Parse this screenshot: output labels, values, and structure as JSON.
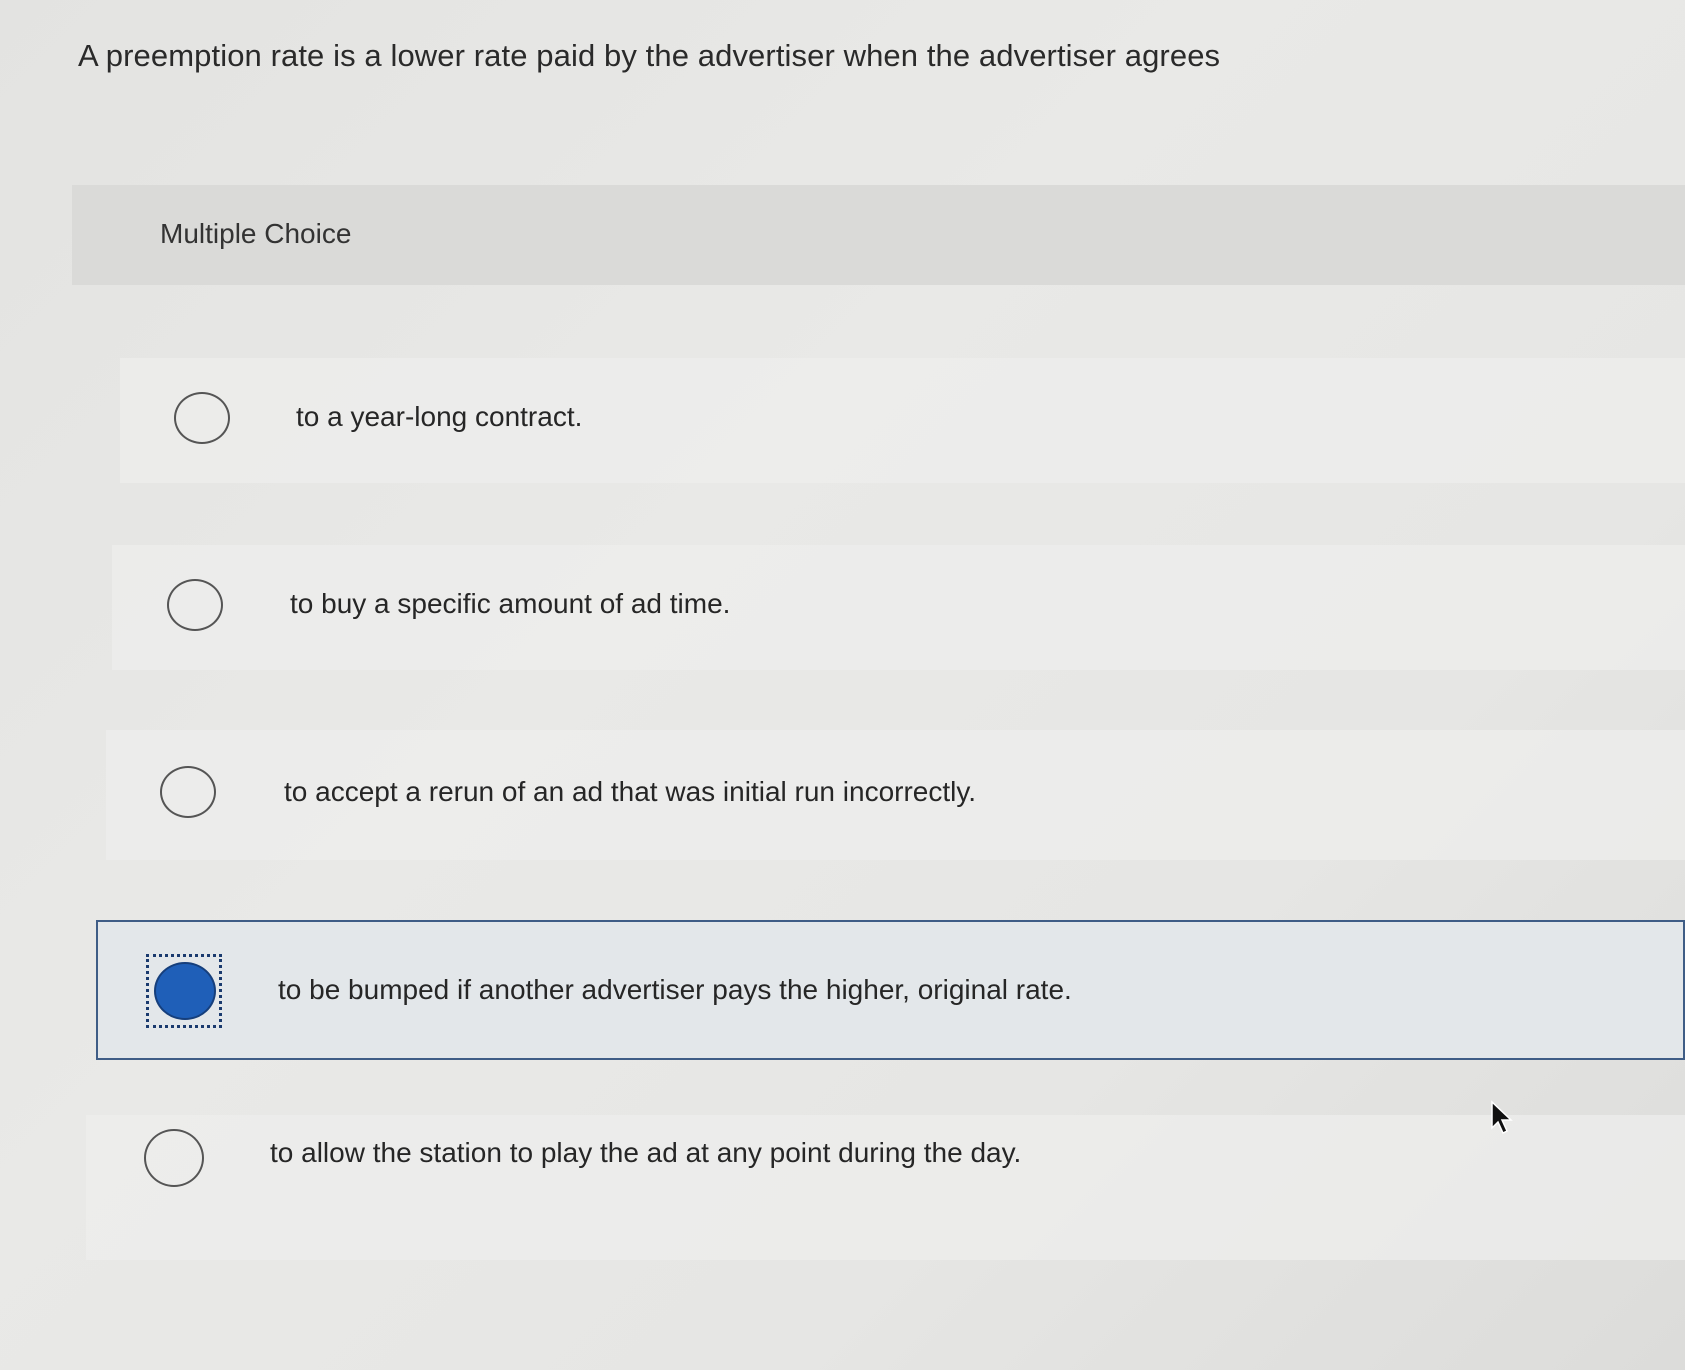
{
  "question": {
    "text": "A preemption rate is a lower rate paid by the advertiser when the advertiser agrees"
  },
  "section": {
    "label": "Multiple Choice"
  },
  "options": [
    {
      "label": "to a year-long contract.",
      "selected": false
    },
    {
      "label": "to buy a specific amount of ad time.",
      "selected": false
    },
    {
      "label": "to accept a rerun of an ad that was initial run incorrectly.",
      "selected": false
    },
    {
      "label": "to be bumped if another advertiser pays the higher, original rate.",
      "selected": true
    },
    {
      "label": "to allow the station to play the ad at any point during the day.",
      "selected": false
    }
  ],
  "colors": {
    "selected_fill": "#1f5fb8",
    "selected_border": "#3f5d86"
  },
  "icons": {
    "cursor": "mouse-pointer-icon"
  }
}
